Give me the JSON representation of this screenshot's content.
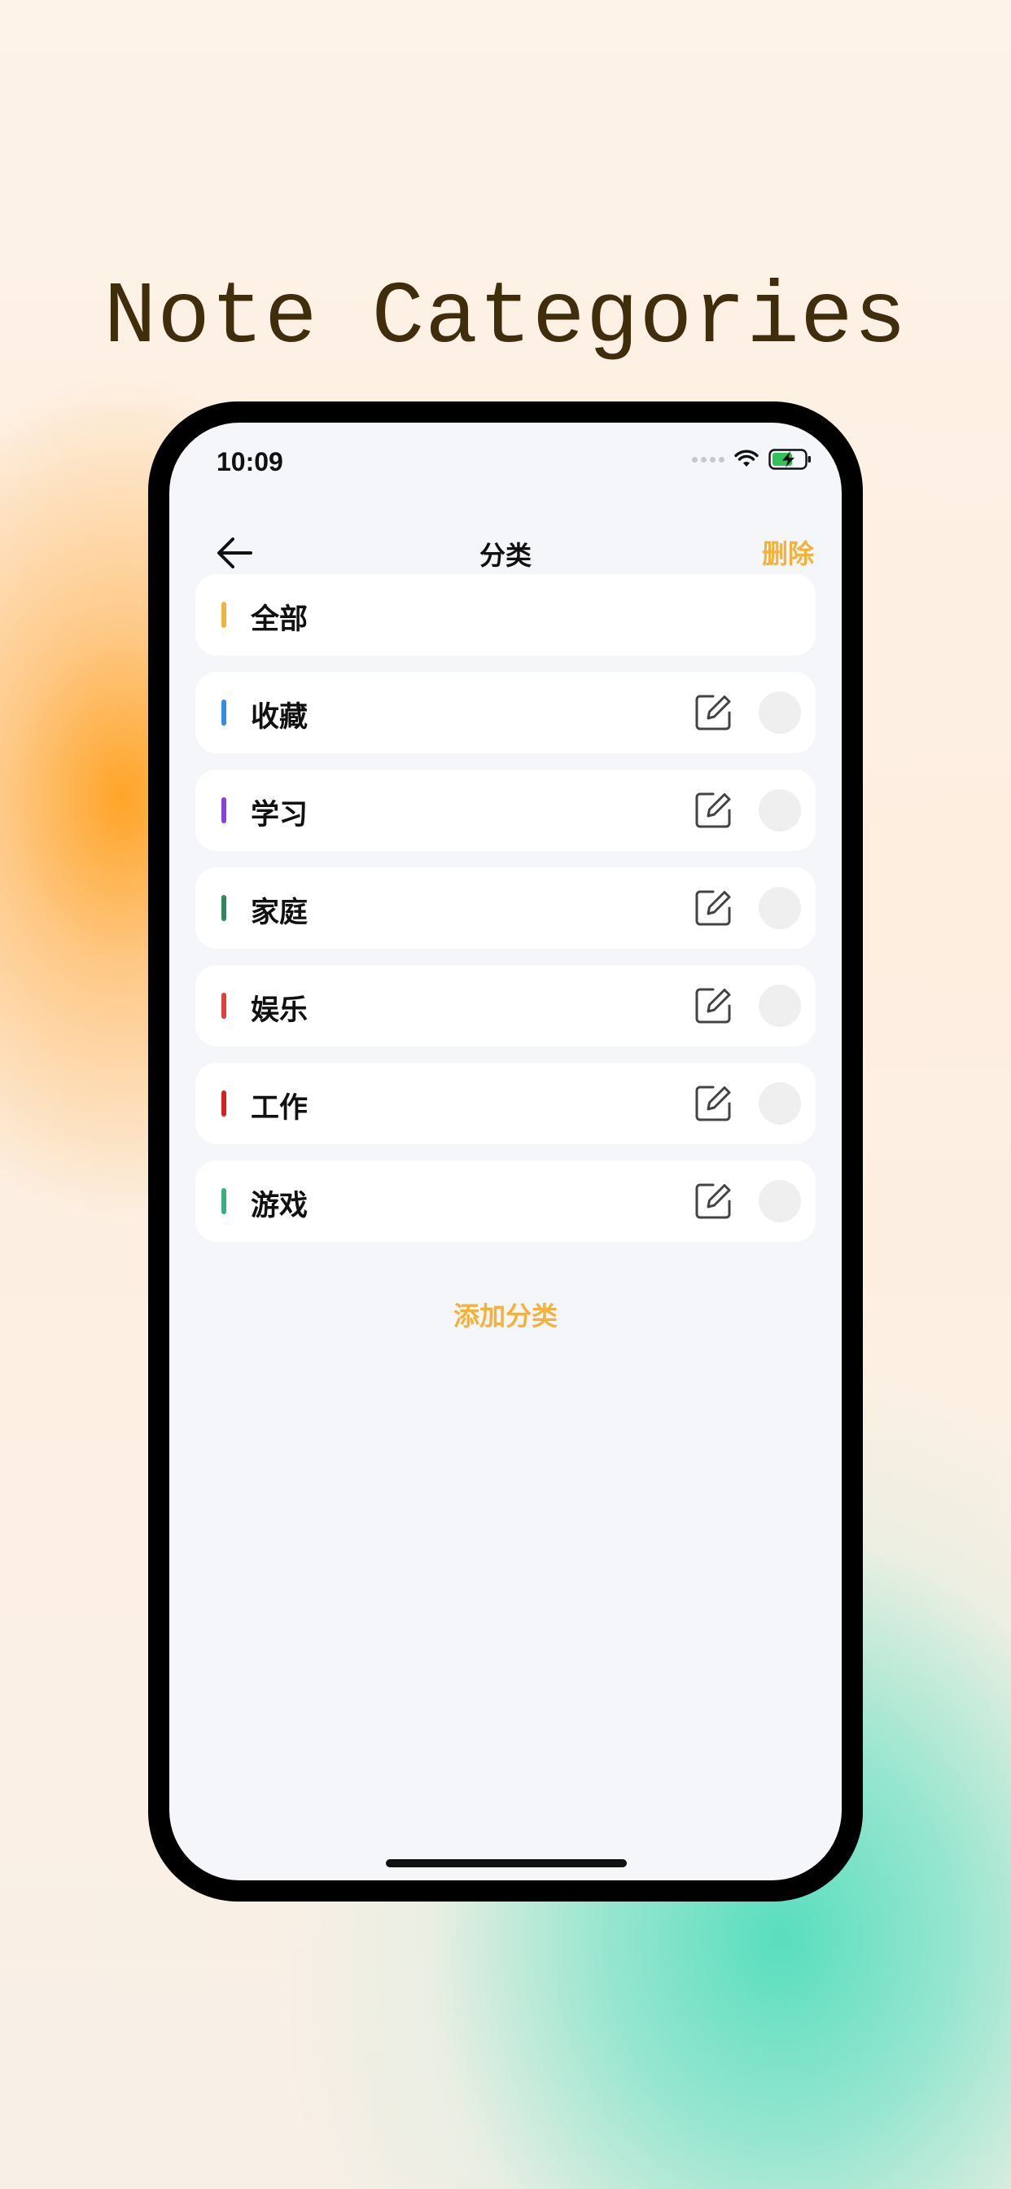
{
  "hero": {
    "title": "Note Categories"
  },
  "status_bar": {
    "time": "10:09"
  },
  "nav": {
    "title": "分类",
    "delete_label": "删除"
  },
  "categories": [
    {
      "label": "全部",
      "color": "#f0b43c",
      "editable": false
    },
    {
      "label": "收藏",
      "color": "#2f8fe8",
      "editable": true
    },
    {
      "label": "学习",
      "color": "#8a3ee0",
      "editable": true
    },
    {
      "label": "家庭",
      "color": "#2a8a5a",
      "editable": true
    },
    {
      "label": "娱乐",
      "color": "#e0403c",
      "editable": true
    },
    {
      "label": "工作",
      "color": "#d9201c",
      "editable": true
    },
    {
      "label": "游戏",
      "color": "#36b07c",
      "editable": true
    }
  ],
  "add_category_label": "添加分类",
  "colors": {
    "accent": "#f4b13c",
    "screen_bg": "#f5f6fa",
    "card_bg": "#ffffff"
  },
  "icons": {
    "back": "back-arrow-icon",
    "edit": "edit-icon",
    "wifi": "wifi-icon",
    "battery": "battery-charging-icon"
  }
}
